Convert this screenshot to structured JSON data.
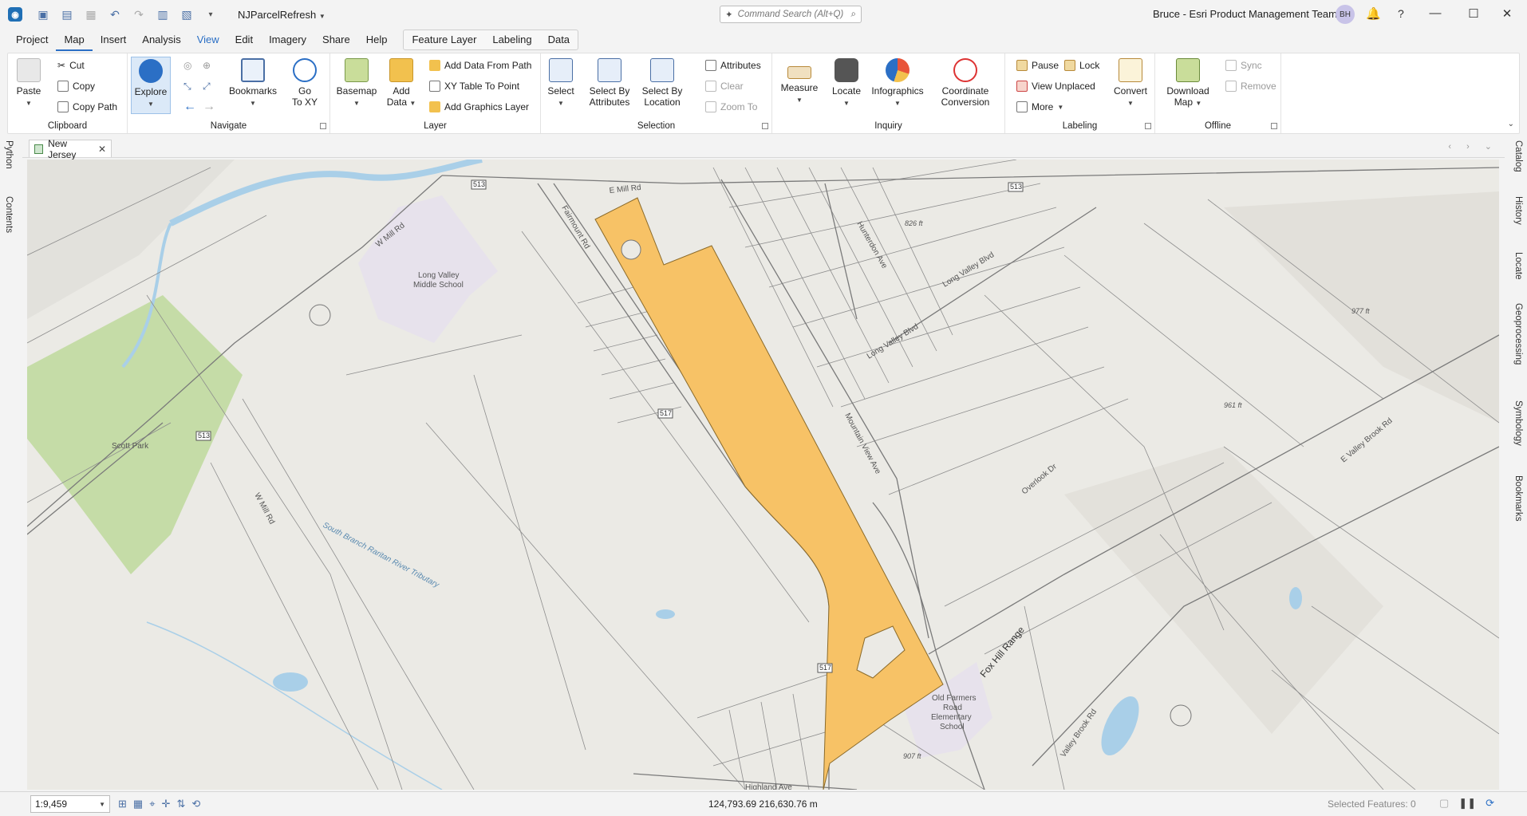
{
  "titlebar": {
    "app_icon": "arcgis-pro-icon",
    "project_name": "NJParcelRefresh",
    "command_search_placeholder": "Command Search (Alt+Q)",
    "user": "Bruce - Esri Product Management Team",
    "avatar_initials": "BH",
    "help": "?"
  },
  "menu": {
    "items": [
      "Project",
      "Map",
      "Insert",
      "Analysis",
      "View",
      "Edit",
      "Imagery",
      "Share",
      "Help"
    ],
    "active": "Map",
    "contextual": [
      "Feature Layer",
      "Labeling",
      "Data"
    ]
  },
  "ribbon": {
    "clipboard": {
      "label": "Clipboard",
      "paste": "Paste",
      "cut": "Cut",
      "copy": "Copy",
      "copy_path": "Copy Path"
    },
    "navigate": {
      "label": "Navigate",
      "explore": "Explore",
      "bookmarks": "Bookmarks",
      "go_to_xy_1": "Go",
      "go_to_xy_2": "To XY"
    },
    "layer": {
      "label": "Layer",
      "basemap": "Basemap",
      "add_data_1": "Add",
      "add_data_2": "Data",
      "add_data_from_path": "Add Data From Path",
      "xy_table_to_point": "XY Table To Point",
      "add_graphics_layer": "Add Graphics Layer"
    },
    "selection": {
      "label": "Selection",
      "select": "Select",
      "select_by_attributes_1": "Select By",
      "select_by_attributes_2": "Attributes",
      "select_by_location_1": "Select By",
      "select_by_location_2": "Location",
      "attributes": "Attributes",
      "clear": "Clear",
      "zoom_to": "Zoom To"
    },
    "inquiry": {
      "label": "Inquiry",
      "measure": "Measure",
      "locate": "Locate",
      "infographics": "Infographics",
      "coordinate_conversion_1": "Coordinate",
      "coordinate_conversion_2": "Conversion"
    },
    "labeling": {
      "label": "Labeling",
      "pause": "Pause",
      "lock": "Lock",
      "view_unplaced": "View Unplaced",
      "more": "More",
      "convert": "Convert"
    },
    "offline": {
      "label": "Offline",
      "download_map_1": "Download",
      "download_map_2": "Map",
      "sync": "Sync",
      "remove": "Remove"
    }
  },
  "side_tabs_left": [
    "Python",
    "Contents"
  ],
  "side_tabs_right": [
    "Catalog",
    "History",
    "Locate",
    "Geoprocessing",
    "Symbology",
    "Bookmarks"
  ],
  "map_tab": {
    "title": "New Jersey"
  },
  "map": {
    "labels": {
      "e_mill_rd": "E Mill Rd",
      "w_mill_rd_top": "W Mill Rd",
      "w_mill_rd_mid": "W Mill Rd",
      "school1_l1": "Long Valley",
      "school1_l2": "Middle School",
      "scott_park": "Scott Park",
      "fairmount_rd": "Fairmount Rd",
      "long_valley_blvd_1": "Long Valley Blvd",
      "long_valley_blvd_2": "Long Valley Blvd",
      "hunterdon_ave": "Hunterdon Ave",
      "mountain_view_ave": "Mountain View Ave",
      "fox_hill_range": "Fox Hill Range",
      "overlook_dr": "Overlook Dr",
      "river": "South Branch Raritan River Tributary",
      "highland_ave": "Highland Ave",
      "valley_brook_rd_1": "E Valley Brook Rd",
      "valley_brook_rd_2": "Valley Brook Rd",
      "school2_l1": "Old Farmers",
      "school2_l2": "Road",
      "school2_l3": "Elementary",
      "school2_l4": "School",
      "elev1": "826 ft",
      "elev2": "977 ft",
      "elev3": "961 ft",
      "elev4": "907 ft",
      "route_513a": "513",
      "route_513b": "513",
      "route_513c": "513",
      "route_517a": "517",
      "route_517b": "517"
    },
    "colors": {
      "parcel_highlight": "#f7c266",
      "park": "#c5dca7",
      "school": "#e7e2ec",
      "water": "#a9cfe8",
      "base": "#ebeae5"
    }
  },
  "status": {
    "scale": "1:9,459",
    "coordinates": "124,793.69 216,630.76 m",
    "selected_features": "Selected Features: 0"
  }
}
